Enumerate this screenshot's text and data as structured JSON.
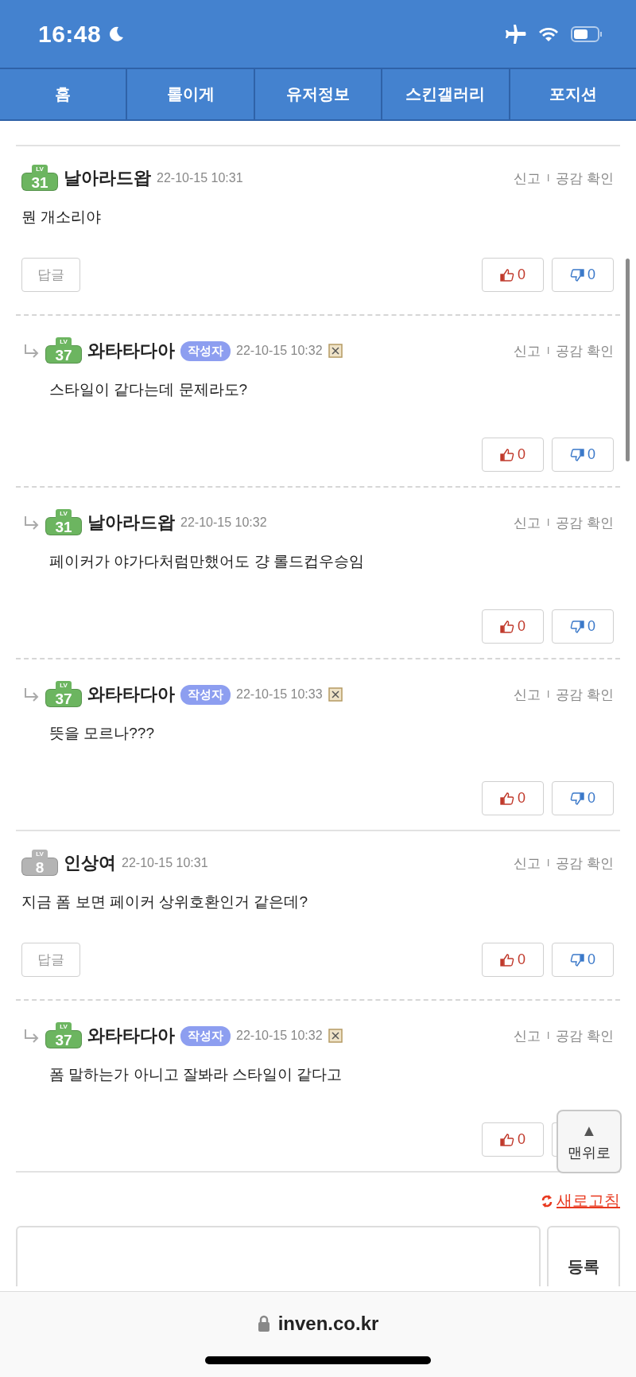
{
  "status_bar": {
    "time": "16:48"
  },
  "tabs": [
    {
      "label": "홈",
      "selected": false
    },
    {
      "label": "롤이게",
      "selected": false
    },
    {
      "label": "유저정보",
      "selected": false
    },
    {
      "label": "스킨갤러리",
      "selected": false
    },
    {
      "label": "포지션",
      "selected": false
    }
  ],
  "comments": [
    {
      "kind": "comment",
      "level": {
        "tag": "LV",
        "number": "31",
        "color": "#6cb560"
      },
      "author": "날아라드왑",
      "time": "22-10-15 10:31",
      "report": "신고",
      "separator": "I",
      "empathy": "공감 확인",
      "body": "뭔 개소리야",
      "reply_button": "답글",
      "like": "0",
      "dislike": "0"
    },
    {
      "kind": "reply",
      "level": {
        "tag": "LV",
        "number": "37",
        "color": "#6cb560"
      },
      "author": "와타타다아",
      "author_badge": "작성자",
      "time": "22-10-15 10:32",
      "deletable": true,
      "report": "신고",
      "separator": "I",
      "empathy": "공감 확인",
      "body": "스타일이 같다는데 문제라도?",
      "like": "0",
      "dislike": "0"
    },
    {
      "kind": "reply",
      "level": {
        "tag": "LV",
        "number": "31",
        "color": "#6cb560"
      },
      "author": "날아라드왑",
      "time": "22-10-15 10:32",
      "deletable": false,
      "report": "신고",
      "separator": "I",
      "empathy": "공감 확인",
      "body": "페이커가 야가다처럼만했어도 걍 롤드컵우승임",
      "like": "0",
      "dislike": "0"
    },
    {
      "kind": "reply",
      "level": {
        "tag": "LV",
        "number": "37",
        "color": "#6cb560"
      },
      "author": "와타타다아",
      "author_badge": "작성자",
      "time": "22-10-15 10:33",
      "deletable": true,
      "report": "신고",
      "separator": "I",
      "empathy": "공감 확인",
      "body": "뜻을 모르나???",
      "like": "0",
      "dislike": "0"
    },
    {
      "kind": "comment",
      "level": {
        "tag": "LV",
        "number": "8",
        "color": "#b4b4b4"
      },
      "author": "인상여",
      "time": "22-10-15 10:31",
      "report": "신고",
      "separator": "I",
      "empathy": "공감 확인",
      "body": "지금 폼 보면 페이커 상위호환인거 같은데?",
      "reply_button": "답글",
      "like": "0",
      "dislike": "0"
    },
    {
      "kind": "reply",
      "level": {
        "tag": "LV",
        "number": "37",
        "color": "#6cb560"
      },
      "author": "와타타다아",
      "author_badge": "작성자",
      "time": "22-10-15 10:32",
      "deletable": true,
      "report": "신고",
      "separator": "I",
      "empathy": "공감 확인",
      "body": "폼 말하는가 아니고 잘봐라 스타일이 같다고",
      "like": "0"
    }
  ],
  "refresh_link": "새로고침",
  "submit_button": "등록",
  "scroll_top_button": {
    "arrow": "▲",
    "label": "맨위로"
  },
  "browser_bar": {
    "url": "inven.co.kr"
  }
}
